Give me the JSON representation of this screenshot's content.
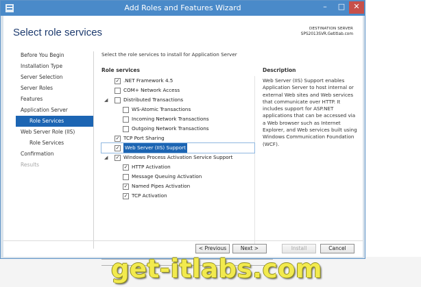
{
  "window": {
    "title": "Add Roles and Features Wizard"
  },
  "header": {
    "page_title": "Select role services",
    "destination_label": "DESTINATION SERVER",
    "destination_value": "SPS2013SVR.Getitlab.com"
  },
  "nav": {
    "items": [
      {
        "label": "Before You Begin",
        "state": "normal"
      },
      {
        "label": "Installation Type",
        "state": "normal"
      },
      {
        "label": "Server Selection",
        "state": "normal"
      },
      {
        "label": "Server Roles",
        "state": "normal"
      },
      {
        "label": "Features",
        "state": "normal"
      },
      {
        "label": "Application Server",
        "state": "normal"
      },
      {
        "label": "Role Services",
        "state": "active"
      },
      {
        "label": "Web Server Role (IIS)",
        "state": "normal"
      },
      {
        "label": "Role Services",
        "state": "normal"
      },
      {
        "label": "Confirmation",
        "state": "normal"
      },
      {
        "label": "Results",
        "state": "disabled"
      }
    ]
  },
  "main": {
    "intro": "Select the role services to install for Application Server",
    "column_header": "Role services",
    "services": [
      {
        "label": ".NET Framework 4.5",
        "checked": true,
        "level": 0,
        "expander": ""
      },
      {
        "label": "COM+ Network Access",
        "checked": false,
        "level": 0,
        "expander": ""
      },
      {
        "label": "Distributed Transactions",
        "checked": false,
        "level": 0,
        "expander": "◢"
      },
      {
        "label": "WS-Atomic Transactions",
        "checked": false,
        "level": 1,
        "expander": ""
      },
      {
        "label": "Incoming Network Transactions",
        "checked": false,
        "level": 1,
        "expander": ""
      },
      {
        "label": "Outgoing Network Transactions",
        "checked": false,
        "level": 1,
        "expander": ""
      },
      {
        "label": "TCP Port Sharing",
        "checked": true,
        "level": 0,
        "expander": ""
      },
      {
        "label": "Web Server (IIS) Support",
        "checked": true,
        "level": 0,
        "expander": "",
        "selected": true
      },
      {
        "label": "Windows Process Activation Service Support",
        "checked": true,
        "level": 0,
        "expander": "◢"
      },
      {
        "label": "HTTP Activation",
        "checked": true,
        "level": 1,
        "expander": ""
      },
      {
        "label": "Message Queuing Activation",
        "checked": false,
        "level": 1,
        "expander": ""
      },
      {
        "label": "Named Pipes Activation",
        "checked": true,
        "level": 1,
        "expander": ""
      },
      {
        "label": "TCP Activation",
        "checked": true,
        "level": 1,
        "expander": ""
      }
    ]
  },
  "description": {
    "title": "Description",
    "text": "Web Server (IIS) Support enables Application Server to host internal or external Web sites and Web services that communicate over HTTP. It includes support for ASP.NET applications that can be accessed via a Web browser such as Internet Explorer, and Web services built using Windows Communication Foundation (WCF)."
  },
  "buttons": {
    "previous": "< Previous",
    "next": "Next >",
    "install": "Install",
    "cancel": "Cancel"
  },
  "window_controls": {
    "minimize": "–",
    "maximize": "□",
    "close": "✕"
  },
  "watermark": "get-itlabs.com",
  "colors": {
    "titlebar": "#4a8ac9",
    "selection": "#1c65b3",
    "close": "#c7504a",
    "watermark": "#f2ea4e"
  }
}
